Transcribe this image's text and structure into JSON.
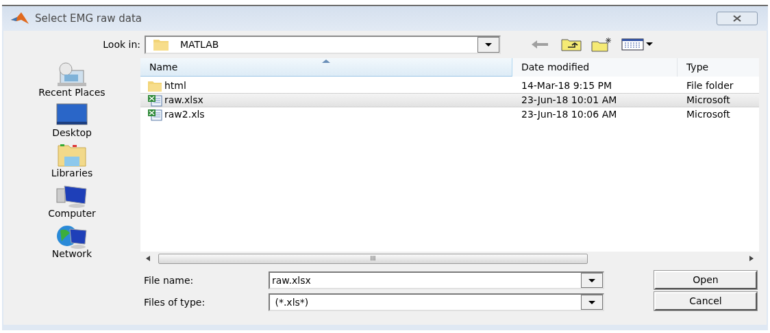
{
  "window": {
    "title": "Select EMG raw data"
  },
  "look_in": {
    "label": "Look in:",
    "value": "MATLAB"
  },
  "places": [
    {
      "label": "Recent Places",
      "kind": "recent"
    },
    {
      "label": "Desktop",
      "kind": "desktop"
    },
    {
      "label": "Libraries",
      "kind": "libraries"
    },
    {
      "label": "Computer",
      "kind": "computer"
    },
    {
      "label": "Network",
      "kind": "network"
    }
  ],
  "table": {
    "columns": [
      "Name",
      "Date modified",
      "Type"
    ],
    "rows": [
      {
        "kind": "folder",
        "name": "html",
        "date": "14-Mar-18 9:15 PM",
        "type": "File folder",
        "selected": false
      },
      {
        "kind": "excel",
        "name": "raw.xlsx",
        "date": "23-Jun-18 10:01 AM",
        "type": "Microsoft",
        "selected": true
      },
      {
        "kind": "excel",
        "name": "raw2.xls",
        "date": "23-Jun-18 10:06 AM",
        "type": "Microsoft",
        "selected": false
      }
    ]
  },
  "scrollbar": {
    "grip": "III"
  },
  "file_name": {
    "label": "File name:",
    "value": "raw.xlsx"
  },
  "file_type": {
    "label": "Files of type:",
    "value": " (*.xls*)"
  },
  "buttons": [
    "Open",
    "Cancel"
  ]
}
